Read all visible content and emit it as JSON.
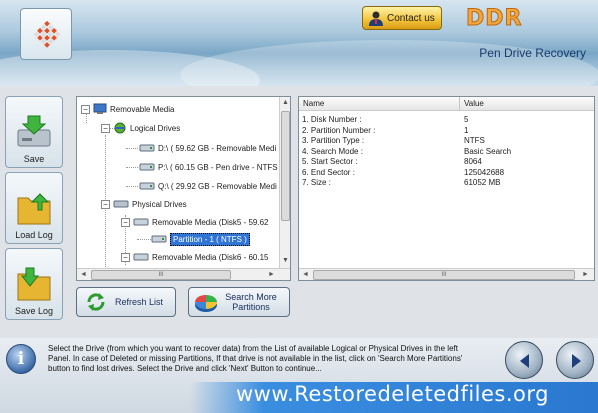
{
  "header": {
    "brand": "DDR",
    "product": "Pen Drive Recovery",
    "contact_label": "Contact us"
  },
  "sidebar": {
    "items": [
      {
        "label": "Save",
        "icon": "save-icon"
      },
      {
        "label": "Load Log",
        "icon": "load-log-icon"
      },
      {
        "label": "Save Log",
        "icon": "save-log-icon"
      }
    ]
  },
  "tree": {
    "root": "Removable Media",
    "logical_group": "Logical Drives",
    "logical_drives": [
      "D:\\ ( 59.62 GB - Removable Medi",
      "P:\\ ( 60.15 GB - Pen drive - NTFS",
      "Q:\\ ( 29.92 GB - Removable Medi"
    ],
    "physical_group": "Physical Drives",
    "physical_disks": [
      "Removable Media (Disk5 - 59.62",
      "Removable Media (Disk6 - 60.15"
    ],
    "selected_partition": "Partition - 1 ( NTFS )",
    "scroll_left_glyph": "◄",
    "scroll_right_glyph": "►",
    "scroll_up_glyph": "▲",
    "scroll_down_glyph": "▼",
    "grip": "III"
  },
  "properties": {
    "columns": [
      "Name",
      "Value"
    ],
    "rows": [
      {
        "name": "1. Disk Number :",
        "value": "5"
      },
      {
        "name": "2. Partition Number :",
        "value": "1"
      },
      {
        "name": "3. Partition Type :",
        "value": "NTFS"
      },
      {
        "name": "4. Search Mode :",
        "value": "Basic Search"
      },
      {
        "name": "5. Start Sector :",
        "value": "8064"
      },
      {
        "name": "6. End Sector :",
        "value": "125042688"
      },
      {
        "name": "7. Size :",
        "value": "61052 MB"
      }
    ]
  },
  "actions": {
    "refresh_label": "Refresh List",
    "search_more_label": "Search More Partitions"
  },
  "status": {
    "info_glyph": "i",
    "text": "Select the Drive (from which you want to recover data) from the List of available Logical or Physical Drives in the left Panel. In case of Deleted or missing Partitions, If that drive is not available in the list, click on 'Search More Partitions' button to find lost drives. Select the Drive and click 'Next' Button to continue..."
  },
  "website": "www.Restoredeletedfiles.org",
  "colors": {
    "accent_blue": "#2a78d0",
    "brand_orange": "#f2a63b",
    "selection": "#3074d6",
    "contact_gold": "#f2c33a"
  }
}
